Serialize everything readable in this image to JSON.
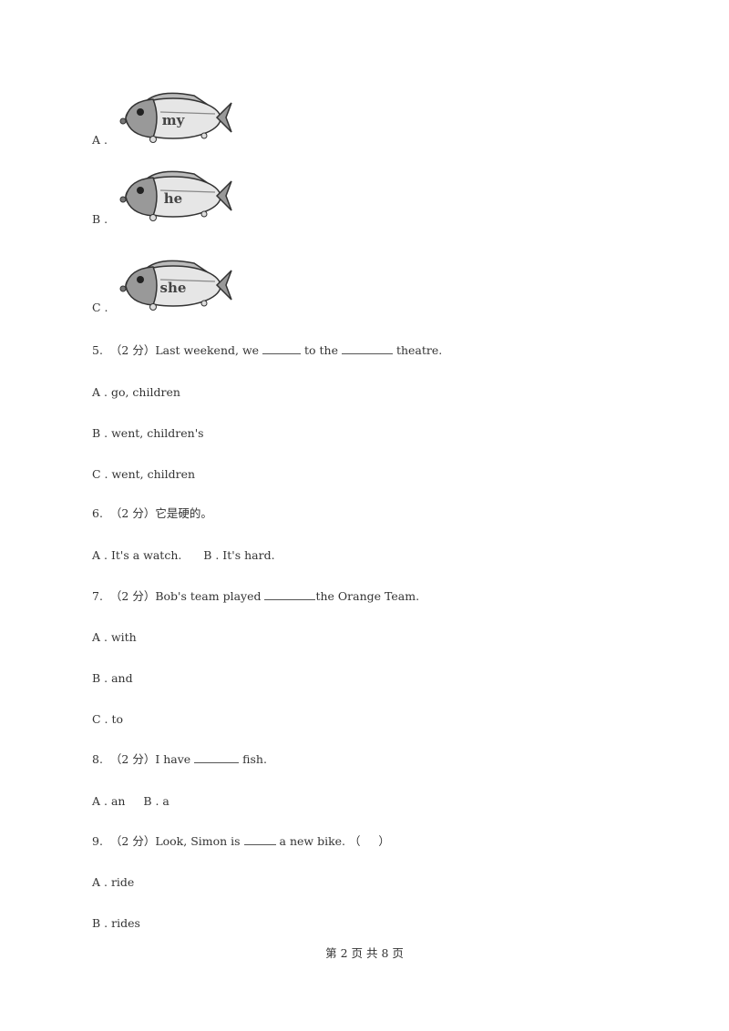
{
  "prev_question_options": [
    {
      "label": "A .",
      "fish_word": "my"
    },
    {
      "label": "B .",
      "fish_word": "he"
    },
    {
      "label": "C .",
      "fish_word": "she"
    }
  ],
  "questions": [
    {
      "number": "5.",
      "score": "（2 分）",
      "stem_parts": [
        "Last weekend, we ",
        " to the ",
        " theatre."
      ],
      "options": [
        "A . go, children",
        "B . went, children's",
        "C . went, children"
      ]
    },
    {
      "number": "6.",
      "score": "（2 分）",
      "stem": "它是硬的。",
      "options_inline": [
        "A . It's a watch.",
        "B . It's hard."
      ]
    },
    {
      "number": "7.",
      "score": "（2 分）",
      "stem_parts": [
        "Bob's team played ",
        "the Orange Team."
      ],
      "options": [
        "A . with",
        "B . and",
        "C . to"
      ]
    },
    {
      "number": "8.",
      "score": "（2 分）",
      "stem_parts": [
        "I have ",
        " fish."
      ],
      "options_inline": [
        "A . an",
        "B . a"
      ]
    },
    {
      "number": "9.",
      "score": "（2 分）",
      "stem_parts": [
        "Look, Simon is ",
        " a new bike. （     ）"
      ],
      "options": [
        "A . ride",
        "B . rides"
      ]
    }
  ],
  "footer": "第 2 页 共 8 页"
}
